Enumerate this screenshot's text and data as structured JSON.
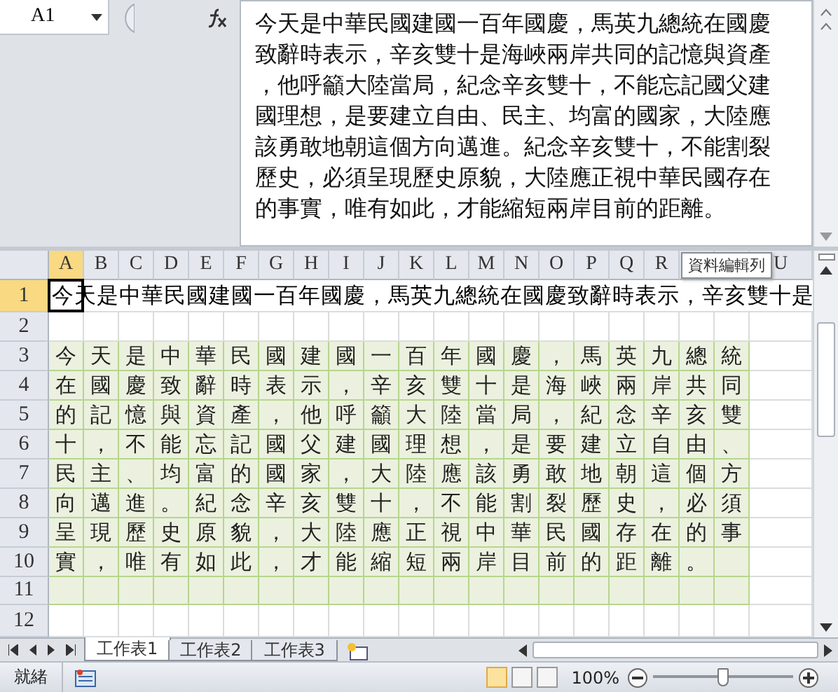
{
  "name_box": "A1",
  "formula_lines": [
    "今天是中華民國建國一百年國慶，馬英九總統在國慶",
    "致辭時表示，辛亥雙十是海峽兩岸共同的記憶與資產",
    "，他呼籲大陸當局，紀念辛亥雙十，不能忘記國父建",
    "國理想，是要建立自由、民主、均富的國家，大陸應",
    "該勇敢地朝這個方向邁進。紀念辛亥雙十，不能割裂",
    "歷史，必須呈現歷史原貌，大陸應正視中華民國存在",
    "的事實，唯有如此，才能縮短兩岸目前的距離。"
  ],
  "tooltip": "資料編輯列",
  "columns": [
    {
      "label": "A",
      "selected": true
    },
    {
      "label": "B",
      "selected": false
    },
    {
      "label": "C",
      "selected": false
    },
    {
      "label": "D",
      "selected": false
    },
    {
      "label": "E",
      "selected": false
    },
    {
      "label": "F",
      "selected": false
    },
    {
      "label": "G",
      "selected": false
    },
    {
      "label": "H",
      "selected": false
    },
    {
      "label": "I",
      "selected": false
    },
    {
      "label": "J",
      "selected": false
    },
    {
      "label": "K",
      "selected": false
    },
    {
      "label": "L",
      "selected": false
    },
    {
      "label": "M",
      "selected": false
    },
    {
      "label": "N",
      "selected": false
    },
    {
      "label": "O",
      "selected": false
    },
    {
      "label": "P",
      "selected": false
    },
    {
      "label": "Q",
      "selected": false
    },
    {
      "label": "R",
      "selected": false
    },
    {
      "selected": false
    },
    {
      "selected": false
    },
    {
      "label": "U",
      "selected": false
    }
  ],
  "rows": [
    {
      "label": "1",
      "kind": "overflow",
      "selected": true,
      "text": "今天是中華民國建國一百年國慶，馬英九總統在國慶致辭時表示，辛亥雙十是"
    },
    {
      "label": "2",
      "kind": "cells",
      "selected": false,
      "shaded": false,
      "cells": []
    },
    {
      "label": "3",
      "kind": "cells",
      "selected": false,
      "shaded": true,
      "cells": [
        "今",
        "天",
        "是",
        "中",
        "華",
        "民",
        "國",
        "建",
        "國",
        "一",
        "百",
        "年",
        "國",
        "慶",
        "，",
        "馬",
        "英",
        "九",
        "總",
        "統"
      ]
    },
    {
      "label": "4",
      "kind": "cells",
      "selected": false,
      "shaded": true,
      "cells": [
        "在",
        "國",
        "慶",
        "致",
        "辭",
        "時",
        "表",
        "示",
        "，",
        "辛",
        "亥",
        "雙",
        "十",
        "是",
        "海",
        "峽",
        "兩",
        "岸",
        "共",
        "同"
      ]
    },
    {
      "label": "5",
      "kind": "cells",
      "selected": false,
      "shaded": true,
      "cells": [
        "的",
        "記",
        "憶",
        "與",
        "資",
        "產",
        "，",
        "他",
        "呼",
        "籲",
        "大",
        "陸",
        "當",
        "局",
        "，",
        "紀",
        "念",
        "辛",
        "亥",
        "雙"
      ]
    },
    {
      "label": "6",
      "kind": "cells",
      "selected": false,
      "shaded": true,
      "cells": [
        "十",
        "，",
        "不",
        "能",
        "忘",
        "記",
        "國",
        "父",
        "建",
        "國",
        "理",
        "想",
        "，",
        "是",
        "要",
        "建",
        "立",
        "自",
        "由",
        "、"
      ]
    },
    {
      "label": "7",
      "kind": "cells",
      "selected": false,
      "shaded": true,
      "cells": [
        "民",
        "主",
        "、",
        "均",
        "富",
        "的",
        "國",
        "家",
        "，",
        "大",
        "陸",
        "應",
        "該",
        "勇",
        "敢",
        "地",
        "朝",
        "這",
        "個",
        "方"
      ]
    },
    {
      "label": "8",
      "kind": "cells",
      "selected": false,
      "shaded": true,
      "cells": [
        "向",
        "邁",
        "進",
        "。",
        "紀",
        "念",
        "辛",
        "亥",
        "雙",
        "十",
        "，",
        "不",
        "能",
        "割",
        "裂",
        "歷",
        "史",
        "，",
        "必",
        "須"
      ]
    },
    {
      "label": "9",
      "kind": "cells",
      "selected": false,
      "shaded": true,
      "cells": [
        "呈",
        "現",
        "歷",
        "史",
        "原",
        "貌",
        "，",
        "大",
        "陸",
        "應",
        "正",
        "視",
        "中",
        "華",
        "民",
        "國",
        "存",
        "在",
        "的",
        "事"
      ]
    },
    {
      "label": "10",
      "kind": "cells",
      "selected": false,
      "shaded": true,
      "cells": [
        "實",
        "，",
        "唯",
        "有",
        "如",
        "此",
        "，",
        "才",
        "能",
        "縮",
        "短",
        "兩",
        "岸",
        "目",
        "前",
        "的",
        "距",
        "離",
        "。"
      ]
    },
    {
      "label": "11",
      "kind": "cells",
      "selected": false,
      "shaded": true,
      "cells": []
    },
    {
      "label": "12",
      "kind": "cells",
      "selected": false,
      "shaded": false,
      "cells": []
    }
  ],
  "sheet_tabs": [
    {
      "label": "工作表1",
      "selected": true
    },
    {
      "label": "工作表2",
      "selected": false
    },
    {
      "label": "工作表3",
      "selected": false
    }
  ],
  "status": "就緒",
  "zoom": {
    "reading": "100%",
    "level": 0.5
  }
}
